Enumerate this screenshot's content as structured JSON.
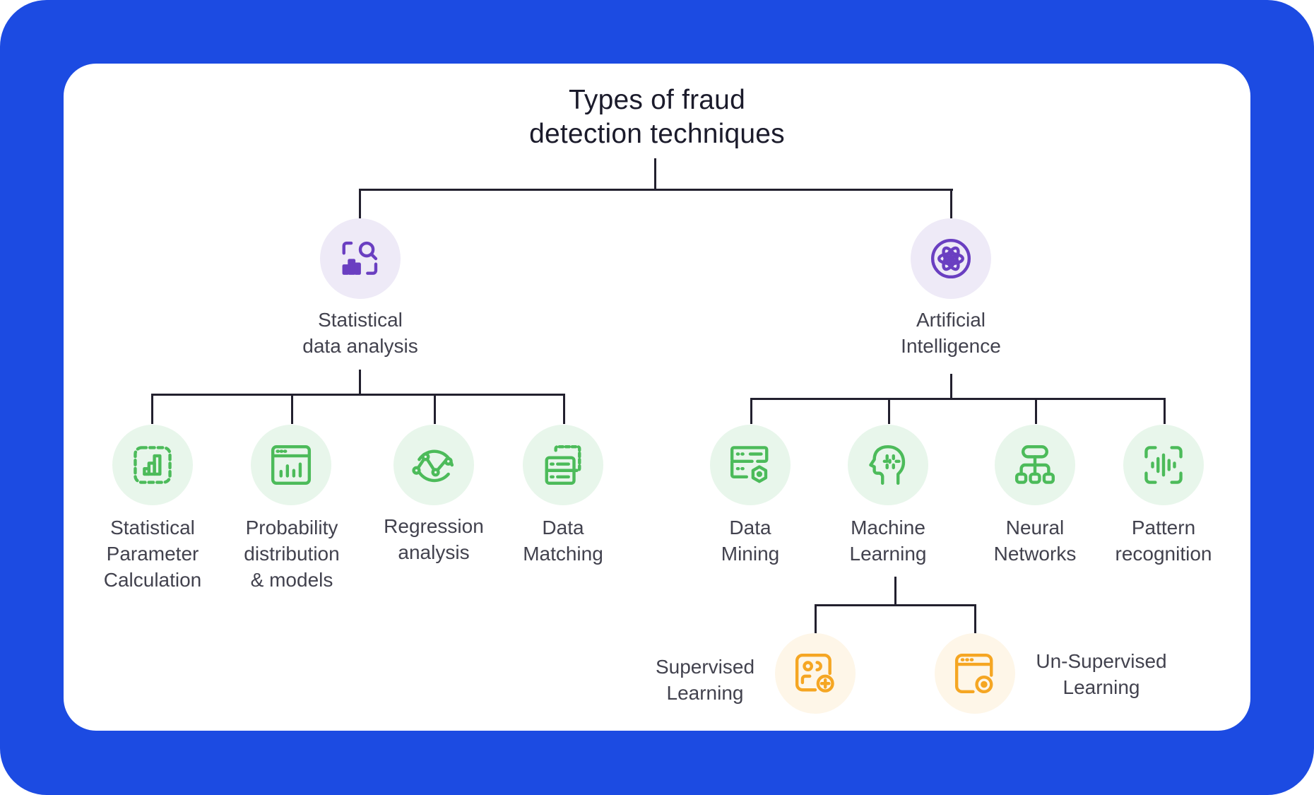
{
  "title": {
    "line1": "Types of fraud",
    "line2": "detection techniques"
  },
  "colors": {
    "frame": "#1c4be2",
    "connector": "#22202e",
    "purple_icon": "#6a3fc1",
    "green_icon": "#4cbb5a",
    "orange_icon": "#f5a623"
  },
  "categories": [
    {
      "icon": "chart-search-icon",
      "label_lines": [
        "Statistical",
        "data analysis"
      ],
      "children": [
        {
          "icon": "dashed-bar-chart-icon",
          "label_lines": [
            "Statistical",
            "Parameter",
            "Calculation"
          ]
        },
        {
          "icon": "browser-bar-chart-icon",
          "label_lines": [
            "Probability",
            "distribution",
            "& models"
          ]
        },
        {
          "icon": "regression-curve-icon",
          "label_lines": [
            "Regression",
            "analysis"
          ]
        },
        {
          "icon": "database-match-icon",
          "label_lines": [
            "Data",
            "Matching"
          ]
        }
      ]
    },
    {
      "icon": "atom-icon",
      "label_lines": [
        "Artificial",
        "Intelligence"
      ],
      "children": [
        {
          "icon": "server-gear-icon",
          "label_lines": [
            "Data",
            "Mining"
          ]
        },
        {
          "icon": "head-brain-icon",
          "label_lines": [
            "Machine",
            "Learning"
          ],
          "children": [
            {
              "icon": "user-card-plus-icon",
              "label_lines": [
                "Supervised",
                "Learning"
              ]
            },
            {
              "icon": "browser-eye-icon",
              "label_lines": [
                "Un-Supervised",
                "Learning"
              ]
            }
          ]
        },
        {
          "icon": "hierarchy-network-icon",
          "label_lines": [
            "Neural",
            "Networks"
          ]
        },
        {
          "icon": "voice-scan-icon",
          "label_lines": [
            "Pattern",
            "recognition"
          ]
        }
      ]
    }
  ]
}
